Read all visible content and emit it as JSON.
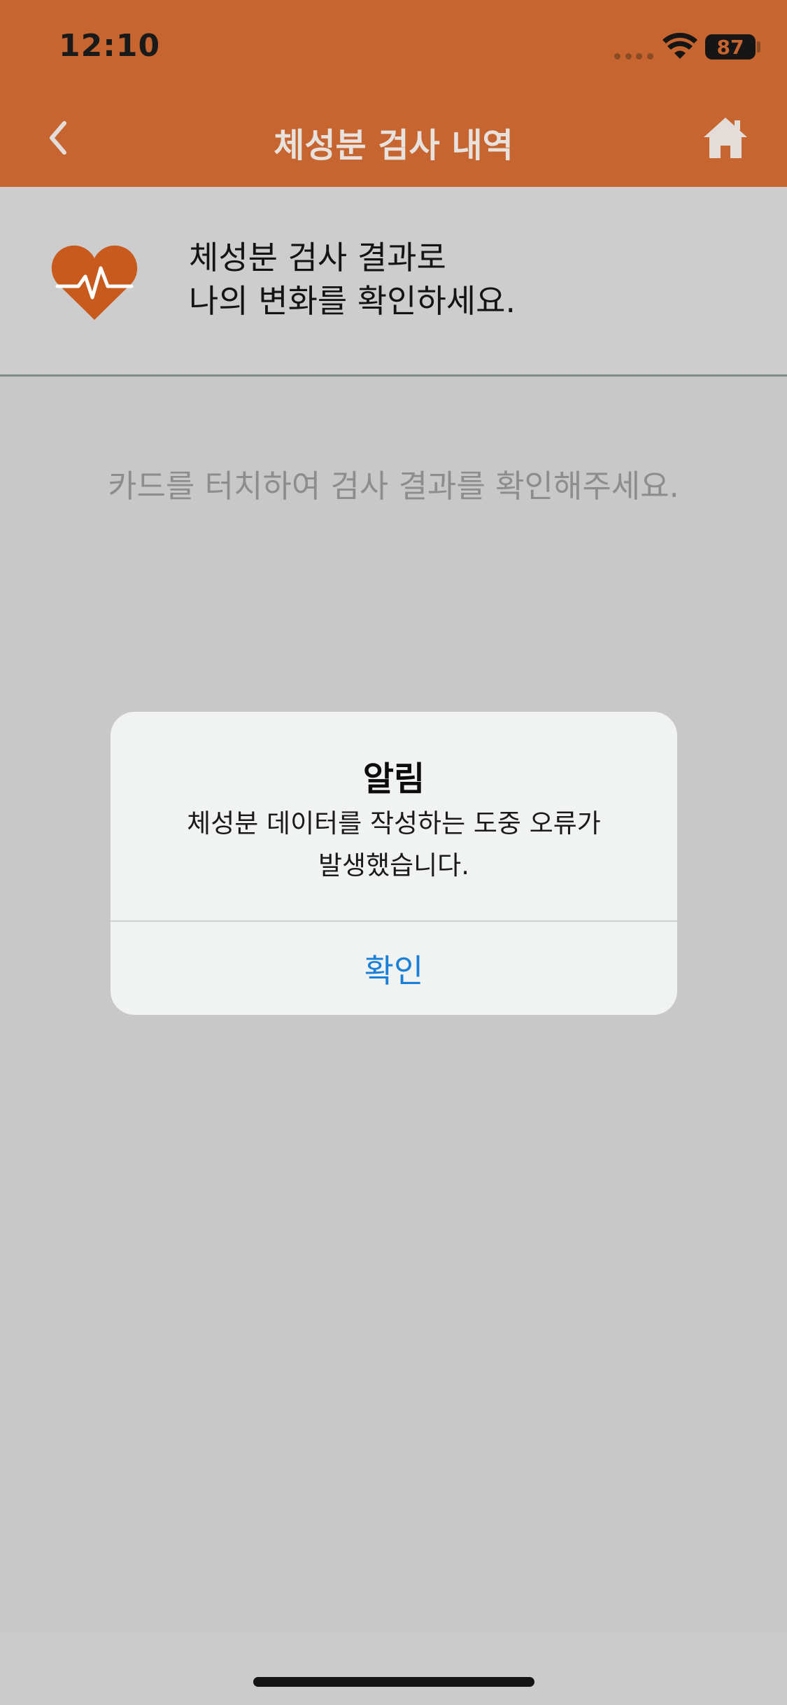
{
  "status_bar": {
    "time": "12:10",
    "battery": "87"
  },
  "header": {
    "title": "체성분 검사 내역"
  },
  "banner": {
    "line1": "체성분 검사 결과로",
    "line2": "나의 변화를 확인하세요."
  },
  "hint": "카드를 터치하여 검사 결과를 확인해주세요.",
  "alert": {
    "title": "알림",
    "message_line1": "체성분 데이터를 작성하는 도중 오류가",
    "message_line2": "발생했습니다.",
    "confirm_label": "확인"
  },
  "colors": {
    "header_bg": "#c6652f",
    "accent_heart": "#c85a1d",
    "alert_button": "#1a7fd6"
  },
  "icons": {
    "back": "chevron-left-icon",
    "home": "home-icon",
    "heart": "heart-pulse-icon",
    "wifi": "wifi-icon",
    "battery": "battery-icon"
  }
}
